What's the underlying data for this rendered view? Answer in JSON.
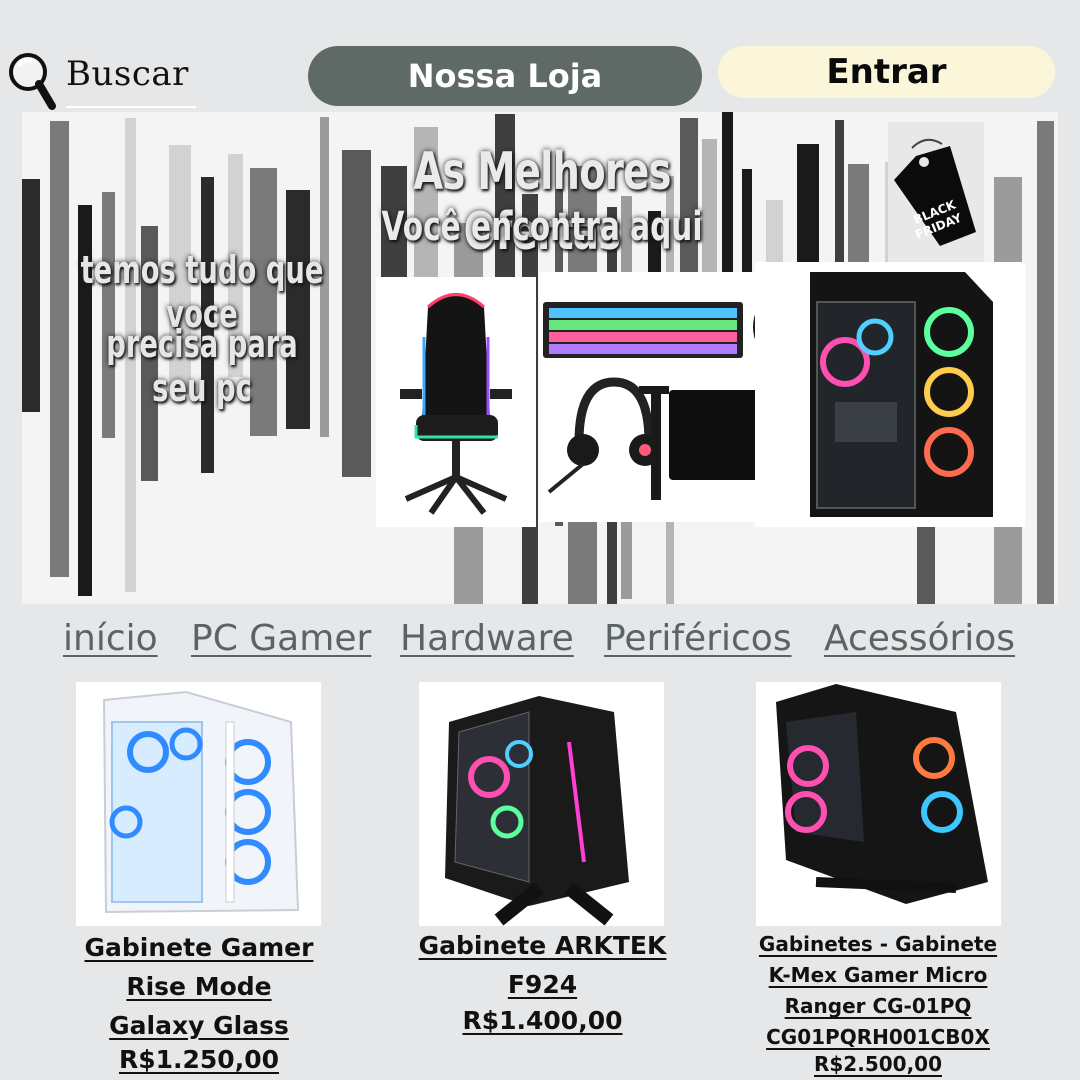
{
  "header": {
    "search_label": "Buscar",
    "store_button": "Nossa Loja",
    "login_button": "Entrar"
  },
  "banner": {
    "headline": "As Melhores Ofertas",
    "subheadline": "Você encontra aqui",
    "tagline_line1": "temos tudo que voce",
    "tagline_line2": "precisa para seu pc",
    "badge_line1": "BLACK",
    "badge_line2": "FRIDAY",
    "images": [
      "gamer-chair",
      "keyboard-mouse-headset-mousepad",
      "gaming-pc-case"
    ]
  },
  "nav": {
    "items": [
      "início",
      "PC Gamer",
      "Hardware",
      "Periféricos",
      "Acessórios"
    ]
  },
  "products": [
    {
      "name_line1": "Gabinete Gamer",
      "name_line2": "Rise Mode",
      "name_line3": "Galaxy Glass",
      "price": "R$1.250,00"
    },
    {
      "name_line1": "Gabinete ARKTEK",
      "name_line2": "F924",
      "price": "R$1.400,00"
    },
    {
      "name_line1": "Gabinetes - Gabinete",
      "name_line2": "K-Mex Gamer Micro",
      "name_line3": "Ranger CG-01PQ",
      "name_line4": "CG01PQRH001CB0X",
      "price": "R$2.500,00"
    }
  ],
  "colors": {
    "page_bg": "#e5e7e9",
    "store_button_bg": "#5f6a67",
    "login_button_bg": "#fbf6d9",
    "nav_link": "#5a6563"
  }
}
